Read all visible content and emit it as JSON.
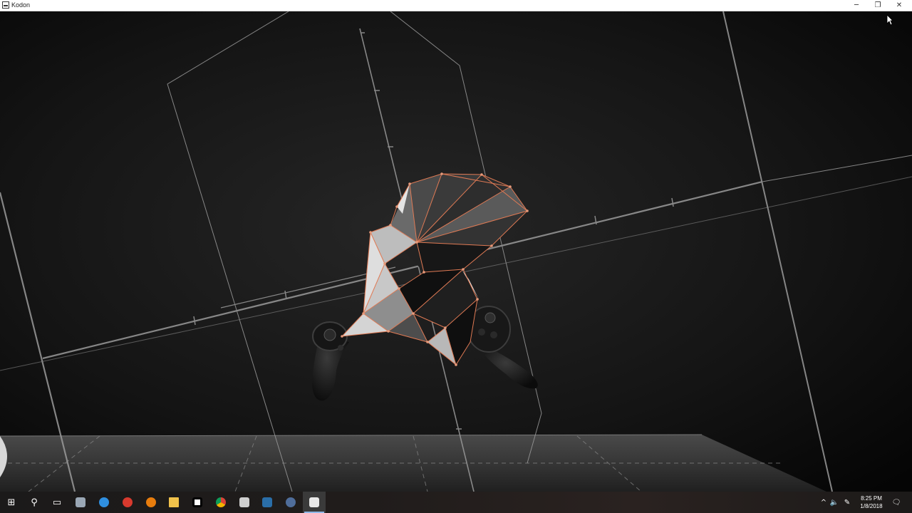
{
  "window": {
    "title": "Kodon",
    "minimize_glyph": "─",
    "maximize_glyph": "❐",
    "close_glyph": "✕"
  },
  "taskbar": {
    "items": [
      {
        "name": "start",
        "icon": "windows-logo-icon",
        "glyph": "⊞"
      },
      {
        "name": "search",
        "icon": "search-icon",
        "glyph": "⚲"
      },
      {
        "name": "task-view",
        "icon": "task-view-icon",
        "glyph": "▭"
      },
      {
        "name": "app-1",
        "icon": "app-window-icon",
        "color": "#9aa7b5"
      },
      {
        "name": "app-2",
        "icon": "edge-browser-icon",
        "color": "#2f8fe0"
      },
      {
        "name": "app-3",
        "icon": "red-app-icon",
        "color": "#d83a2e"
      },
      {
        "name": "app-4",
        "icon": "blender-icon",
        "color": "#e87d0d"
      },
      {
        "name": "app-5",
        "icon": "file-explorer-icon",
        "color": "#f1c24b"
      },
      {
        "name": "app-6",
        "icon": "oculus-icon",
        "color": "#ffffff"
      },
      {
        "name": "app-7",
        "icon": "chrome-icon",
        "color": "#db4437"
      },
      {
        "name": "app-8",
        "icon": "film-icon",
        "color": "#cfcfcf"
      },
      {
        "name": "app-9",
        "icon": "steam-icon",
        "color": "#2a6ea8"
      },
      {
        "name": "app-10",
        "icon": "steamvr-icon",
        "color": "#4f6d9a"
      },
      {
        "name": "app-11",
        "icon": "kodon-icon",
        "color": "#e8e8e8"
      }
    ],
    "tray": {
      "chevron": "^",
      "volume": "🔈",
      "pen": "✎",
      "time": "8:25 PM",
      "date": "1/8/2018",
      "notifications": "🗨"
    }
  },
  "colors": {
    "mesh_edge": "#e07a54",
    "grid_line": "#9a9a9a",
    "taskbar_accent": "#8fb8e8"
  }
}
